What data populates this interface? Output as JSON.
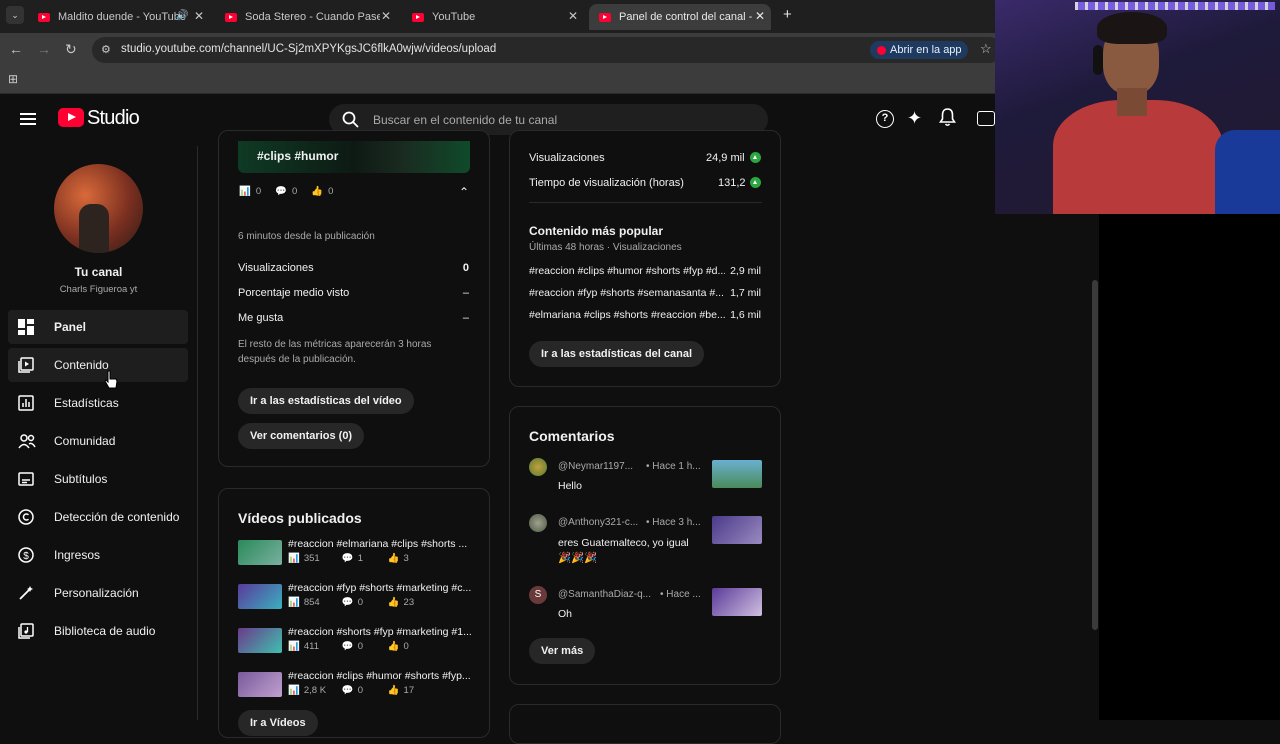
{
  "browser": {
    "tabs": [
      {
        "title": "Maldito duende - YouTube",
        "active": false
      },
      {
        "title": "Soda Stereo - Cuando Pase el T",
        "active": false
      },
      {
        "title": "YouTube",
        "active": false
      },
      {
        "title": "Panel de control del canal - You",
        "active": true
      }
    ],
    "new_tab": "+",
    "url": "studio.youtube.com/channel/UC-Sj2mXPYKgsJC6flkA0wjw/videos/upload",
    "open_app": "Abrir en la app"
  },
  "header": {
    "logo": "Studio",
    "search_placeholder": "Buscar en el contenido de tu canal"
  },
  "sidebar": {
    "channel_title": "Tu canal",
    "channel_name": "Charls Figueroa yt",
    "items": [
      {
        "label": "Panel",
        "icon": "dashboard-icon",
        "active": true
      },
      {
        "label": "Contenido",
        "icon": "content-icon",
        "active": false
      },
      {
        "label": "Estadísticas",
        "icon": "analytics-icon",
        "active": false
      },
      {
        "label": "Comunidad",
        "icon": "community-icon",
        "active": false
      },
      {
        "label": "Subtítulos",
        "icon": "subtitles-icon",
        "active": false
      },
      {
        "label": "Detección de contenido",
        "icon": "copyright-icon",
        "active": false
      },
      {
        "label": "Ingresos",
        "icon": "earn-icon",
        "active": false
      },
      {
        "label": "Personalización",
        "icon": "customization-icon",
        "active": false
      },
      {
        "label": "Biblioteca de audio",
        "icon": "audio-library-icon",
        "active": false
      }
    ]
  },
  "latest_video": {
    "thumb_title": "#clips #humor",
    "stats": {
      "views": "0",
      "comments": "0",
      "likes": "0"
    },
    "since": "6 minutos desde la publicación",
    "metrics": [
      {
        "label": "Visualizaciones",
        "value": "0"
      },
      {
        "label": "Porcentaje medio visto",
        "value": "–"
      },
      {
        "label": "Me gusta",
        "value": "–"
      }
    ],
    "note": "El resto de las métricas aparecerán 3 horas después de la publicación.",
    "btn_stats": "Ir a las estadísticas del vídeo",
    "btn_comments": "Ver comentarios (0)"
  },
  "published": {
    "title": "Vídeos publicados",
    "videos": [
      {
        "title": "#reaccion #elmariana #clips #shorts ...",
        "views": "351",
        "comments": "1",
        "likes": "3"
      },
      {
        "title": "#reaccion #fyp #shorts #marketing #c...",
        "views": "854",
        "comments": "0",
        "likes": "23"
      },
      {
        "title": "#reaccion #shorts #fyp #marketing #1...",
        "views": "411",
        "comments": "0",
        "likes": "0"
      },
      {
        "title": "#reaccion #clips #humor #shorts #fyp...",
        "views": "2,8 K",
        "comments": "0",
        "likes": "17"
      }
    ],
    "more": "Ir a Vídeos"
  },
  "analytics": {
    "metrics": [
      {
        "label": "Visualizaciones",
        "value": "24,9 mil"
      },
      {
        "label": "Tiempo de visualización (horas)",
        "value": "131,2"
      }
    ],
    "popular_title": "Contenido más popular",
    "popular_sub": "Últimas 48 horas · Visualizaciones",
    "popular": [
      {
        "title": "#reaccion #clips #humor #shorts #fyp #d...",
        "value": "2,9 mil"
      },
      {
        "title": "#reaccion #fyp #shorts #semanasanta #...",
        "value": "1,7 mil"
      },
      {
        "title": "#elmariana #clips #shorts #reaccion #be...",
        "value": "1,6 mil"
      }
    ],
    "btn": "Ir a las estadísticas del canal"
  },
  "comments": {
    "title": "Comentarios",
    "items": [
      {
        "author": "@Neymar1197...",
        "time": "• Hace 1 h...",
        "text": "Hello"
      },
      {
        "author": "@Anthony321-c...",
        "time": "• Hace 3 h...",
        "text": "eres Guatemalteco, yo igual 🎉🎉🎉"
      },
      {
        "author": "@SamanthaDiaz-q...",
        "time": "• Hace ...",
        "text": "Oh",
        "initial": "S"
      }
    ],
    "more": "Ver más"
  },
  "colors": {
    "accent": "#ff0033",
    "up": "#2ba640"
  }
}
